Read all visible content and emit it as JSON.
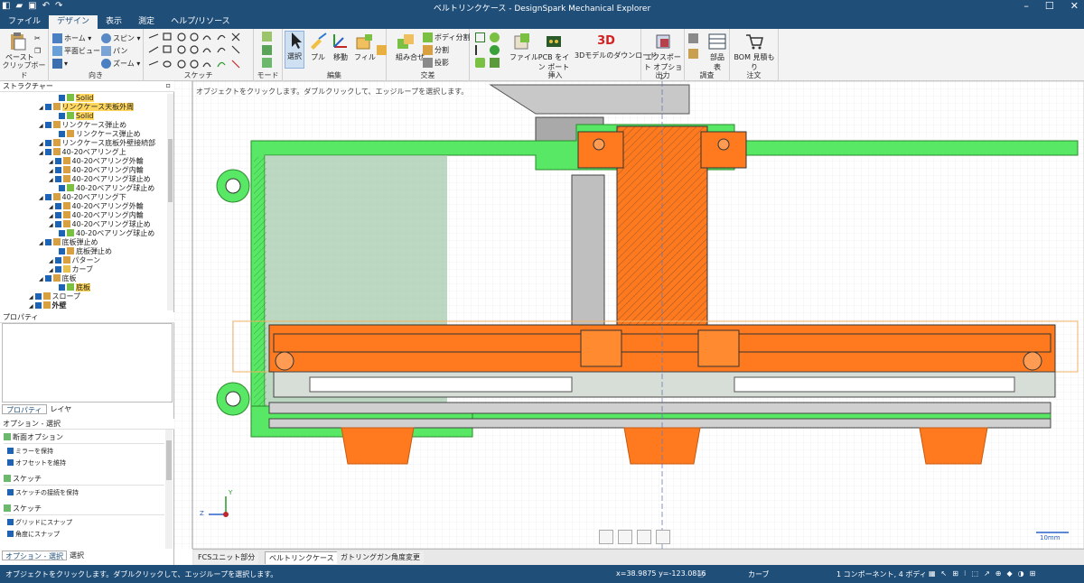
{
  "window": {
    "title": "ベルトリンクケース - DesignSpark Mechanical Explorer"
  },
  "menu": {
    "tabs": [
      "ファイル",
      "デザイン",
      "表示",
      "測定",
      "ヘルプ/リソース"
    ],
    "active": 1
  },
  "ribbon": {
    "clipboard": {
      "paste": "ペースト",
      "label": "クリップボード"
    },
    "orient": {
      "home": "ホーム",
      "plane_view": "平面ビュー",
      "spin": "スピン",
      "pan": "パン",
      "zoom": "ズーム",
      "label": "向き"
    },
    "sketch": {
      "label": "スケッチ"
    },
    "mode": {
      "label": "モード"
    },
    "edit": {
      "select": "選択",
      "pull": "プル",
      "move": "移動",
      "fill": "フィル",
      "label": "編集"
    },
    "intersect": {
      "combine": "組み合せ",
      "split_body": "ボディ分割",
      "split": "分割",
      "project": "投影",
      "label": "交差"
    },
    "insert": {
      "file": "ファイル",
      "pcb_import": "PCB をイン ポート",
      "download3d": "3Dモデルのダウンロード",
      "label": "挿入"
    },
    "output": {
      "export": "エクスポート オプション",
      "label": "出力"
    },
    "survey": {
      "parts_table": "部品 表",
      "label": "調査"
    },
    "order": {
      "bom_quote": "BOM 見積もり",
      "label": "注文"
    }
  },
  "structure": {
    "header": "ストラクチャー",
    "items": [
      {
        "label": "Solid",
        "hl": true,
        "indent": 3
      },
      {
        "label": "リンクケース天板外周",
        "hl": true,
        "indent": 1
      },
      {
        "label": "Solid",
        "hl": true,
        "indent": 3
      },
      {
        "label": "リンクケース弾止め",
        "hl": false,
        "indent": 1
      },
      {
        "label": "リンクケース弾止め",
        "hl": false,
        "indent": 3
      },
      {
        "label": "リンクケース底板外壁接続部",
        "hl": false,
        "indent": 1
      },
      {
        "label": "40-20ベアリング上",
        "hl": false,
        "indent": 1
      },
      {
        "label": "40-20ベアリング外輪",
        "hl": false,
        "indent": 2
      },
      {
        "label": "40-20ベアリング内輪",
        "hl": false,
        "indent": 2
      },
      {
        "label": "40-20ベアリング球止め",
        "hl": false,
        "indent": 2
      },
      {
        "label": "40-20ベアリング球止め",
        "hl": false,
        "indent": 3
      },
      {
        "label": "40-20ベアリング下",
        "hl": false,
        "indent": 1
      },
      {
        "label": "40-20ベアリング外輪",
        "hl": false,
        "indent": 2
      },
      {
        "label": "40-20ベアリング内輪",
        "hl": false,
        "indent": 2
      },
      {
        "label": "40-20ベアリング球止め",
        "hl": false,
        "indent": 2
      },
      {
        "label": "40-20ベアリング球止め",
        "hl": false,
        "indent": 3
      },
      {
        "label": "底板弾止め",
        "hl": false,
        "indent": 1
      },
      {
        "label": "底板弾止め",
        "hl": false,
        "indent": 3
      },
      {
        "label": "パターン",
        "hl": false,
        "indent": 2
      },
      {
        "label": "カーブ",
        "hl": false,
        "indent": 2
      },
      {
        "label": "底板",
        "hl": false,
        "indent": 1
      },
      {
        "label": "底板",
        "hl": true,
        "indent": 3
      },
      {
        "label": "スロープ",
        "hl": false,
        "indent": 0
      },
      {
        "label": "外壁",
        "hl": false,
        "indent": 0
      }
    ]
  },
  "properties": {
    "header": "プロパティ",
    "tabs": [
      "プロパティ",
      "レイヤ"
    ]
  },
  "options": {
    "header": "オプション - 選択",
    "sections": [
      {
        "title": "断面オプション",
        "items": [
          "ミラーを保持",
          "オフセットを維持"
        ]
      },
      {
        "title": "スケッチ",
        "items": [
          "スケッチの接続を保持"
        ]
      },
      {
        "title": "スケッチ",
        "items": [
          "グリッドにスナップ",
          "角度にスナップ"
        ]
      }
    ],
    "bottom_tabs": [
      "オプション - 選択",
      "選択"
    ]
  },
  "canvas": {
    "hint": "オブジェクトをクリックします。ダブルクリックして、エッジループを選択します。",
    "scale_label": "10mm",
    "axis_z": "Z",
    "axis_y": "Y"
  },
  "doc_tabs": [
    {
      "label": "FCSユニット部分",
      "active": false
    },
    {
      "label": "ベルトリンクケース",
      "active": true
    },
    {
      "label": "ガトリングガン角度変更",
      "active": false
    }
  ],
  "status": {
    "message": "オブジェクトをクリックします。ダブルクリックして、エッジループを選択します。",
    "coords": "x=38.9875  y=-123.0816",
    "selection_type": "カーブ",
    "selection_count": "1 コンポーネント, 4 ボディ"
  },
  "colors": {
    "accent": "#1f4e79",
    "orange": "#ff7a1f",
    "green": "#4de35a"
  }
}
